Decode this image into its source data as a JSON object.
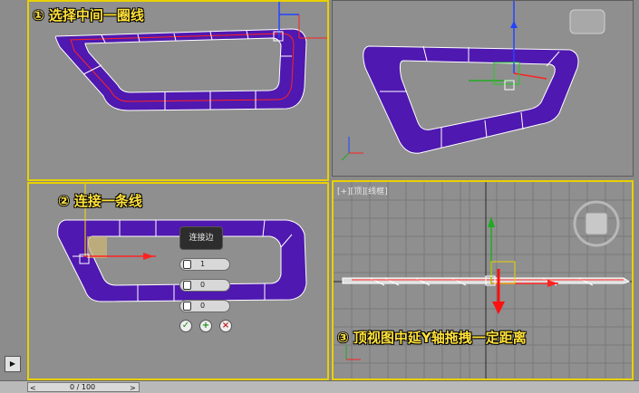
{
  "annotations": {
    "step1": "① 选择中间一圈线",
    "step2": "② 连接一条线",
    "step3": "③ 顶视图中延Y轴拖拽一定距离"
  },
  "caddy": {
    "title": "连接边",
    "segments": "1",
    "pinch": "0",
    "slide": "0",
    "ok_icon": "check-icon",
    "apply_icon": "plus-icon",
    "cancel_icon": "cross-icon"
  },
  "viewport_top": {
    "menu": "[+][顶][线框]"
  },
  "timeline": {
    "frame": "0 / 100",
    "prev": "<",
    "next": ">"
  },
  "colors": {
    "accent_border": "#e8d000",
    "mesh": "#4f18b0",
    "label": "#ffe13a"
  }
}
